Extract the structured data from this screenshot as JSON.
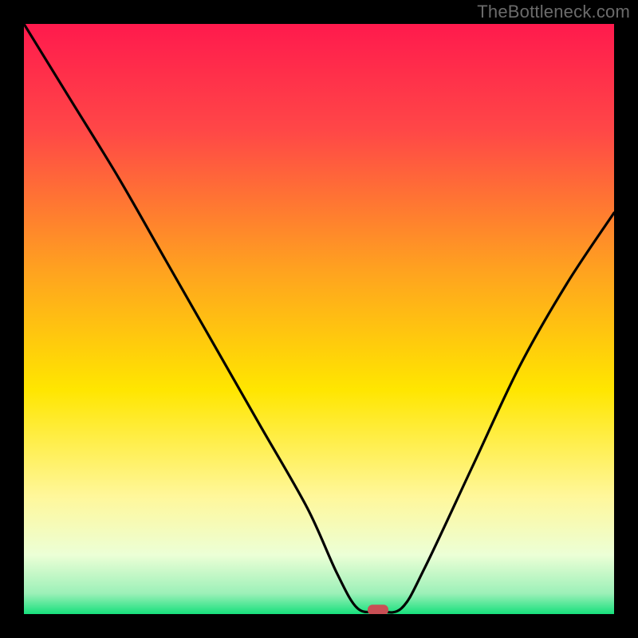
{
  "watermark": "TheBottleneck.com",
  "chart_data": {
    "type": "line",
    "title": "",
    "xlabel": "",
    "ylabel": "",
    "xlim": [
      0,
      100
    ],
    "ylim": [
      0,
      100
    ],
    "series": [
      {
        "name": "curve",
        "x": [
          0,
          8,
          16,
          24,
          32,
          40,
          48,
          53,
          56.5,
          60,
          64,
          68,
          76,
          84,
          92,
          100
        ],
        "y": [
          100,
          87,
          74,
          60,
          46,
          32,
          18,
          7,
          1,
          0.5,
          1,
          8,
          25,
          42,
          56,
          68
        ]
      }
    ],
    "marker": {
      "x": 60,
      "y": 0.5,
      "color": "#c94f55"
    },
    "background": {
      "type": "vertical-gradient",
      "stops": [
        {
          "pos": 0.0,
          "color": "#ff1a4d"
        },
        {
          "pos": 0.18,
          "color": "#ff4747"
        },
        {
          "pos": 0.42,
          "color": "#ffa31f"
        },
        {
          "pos": 0.62,
          "color": "#ffe600"
        },
        {
          "pos": 0.8,
          "color": "#fff79a"
        },
        {
          "pos": 0.9,
          "color": "#ecffd6"
        },
        {
          "pos": 0.965,
          "color": "#9cf0b8"
        },
        {
          "pos": 1.0,
          "color": "#17e07c"
        }
      ]
    }
  }
}
